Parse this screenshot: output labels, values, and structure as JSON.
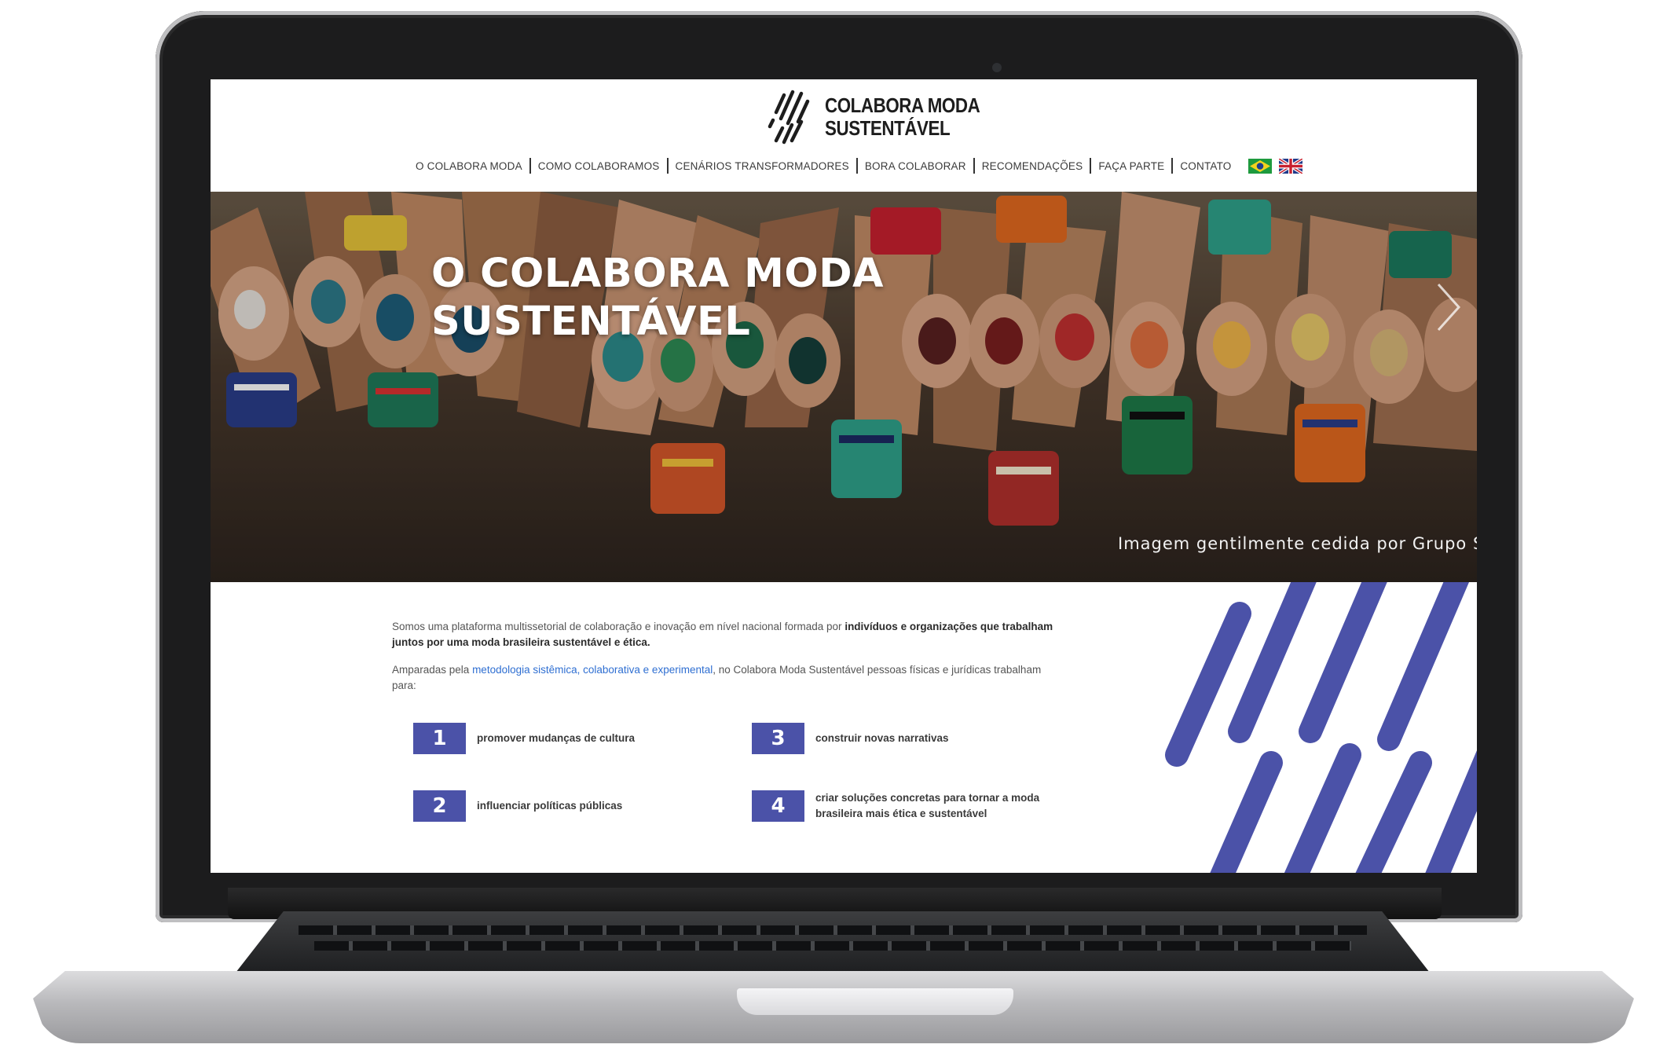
{
  "brand": {
    "line1": "COLABORA MODA",
    "line2": "SUSTENTÁVEL",
    "accent_color": "#4b52a8"
  },
  "nav": {
    "items": [
      "O COLABORA MODA",
      "COMO COLABORAMOS",
      "CENÁRIOS TRANSFORMADORES",
      "BORA COLABORAR",
      "RECOMENDAÇÕES",
      "FAÇA PARTE",
      "CONTATO"
    ],
    "flags": [
      "flag-brazil-icon",
      "flag-uk-icon"
    ]
  },
  "hero": {
    "title_line1": "O COLABORA MODA",
    "title_line2": "SUSTENTÁVEL",
    "caption": "Imagem gentilmente cedida por Grupo S",
    "next_icon": "chevron-right-icon"
  },
  "intro": {
    "p1_text": "Somos uma plataforma multissetorial de colaboração e inovação em nível nacional formada por ",
    "p1_bold": "indivíduos e organizações que trabalham juntos por uma moda brasileira sustentável e ética.",
    "p2_before": "Amparadas pela ",
    "p2_link": "metodologia sistêmica, colaborativa e experimental",
    "p2_after": ", no Colabora Moda Sustentável pessoas físicas e jurídicas trabalham para:"
  },
  "goals": [
    {
      "num": "1",
      "text": "promover mudanças de cultura"
    },
    {
      "num": "2",
      "text": "influenciar políticas públicas"
    },
    {
      "num": "3",
      "text": "construir novas narrativas"
    },
    {
      "num": "4",
      "text": "criar soluções concretas para tornar a moda brasileira mais ética e sustentável"
    }
  ]
}
